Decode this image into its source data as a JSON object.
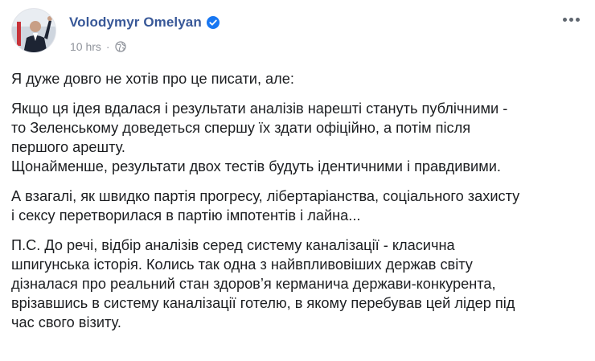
{
  "post": {
    "author": "Volodymyr Omelyan",
    "time": "10 hrs",
    "separator": "·",
    "privacy_icon": "globe-icon",
    "verified_icon": "verified-badge-icon",
    "more_icon": "more-options-icon",
    "paragraphs": [
      "Я дуже довго не хотів про це писати, але:",
      "Якщо ця ідея вдалася і результати аналізів нарешті стануть публічними -\nто Зеленському доведеться спершу їх здати офіційно, а потім після\nпершого арешту.\nЩонайменше, результати двох тестів будуть ідентичними і правдивими.",
      "А взагалі, як швидко партія прогресу, лібертаріанства, соціального захисту\nі сексу перетворилася в партію імпотентів і лайна...",
      "П.С. До речі, відбір аналізів серед систему каналізації - класична\nшпигунська історія. Колись так одна з найвпливовіших держав світу\nдізналася про реальний стан здоров’я керманича держави-конкурента,\nврізавшись в систему каналізації готелю, в якому перебував цей лідер під\nчас свого візиту."
    ]
  },
  "colors": {
    "author_link": "#385898",
    "meta_text": "#90949c",
    "verified": "#1877f2",
    "body_text": "#1c1e21"
  }
}
